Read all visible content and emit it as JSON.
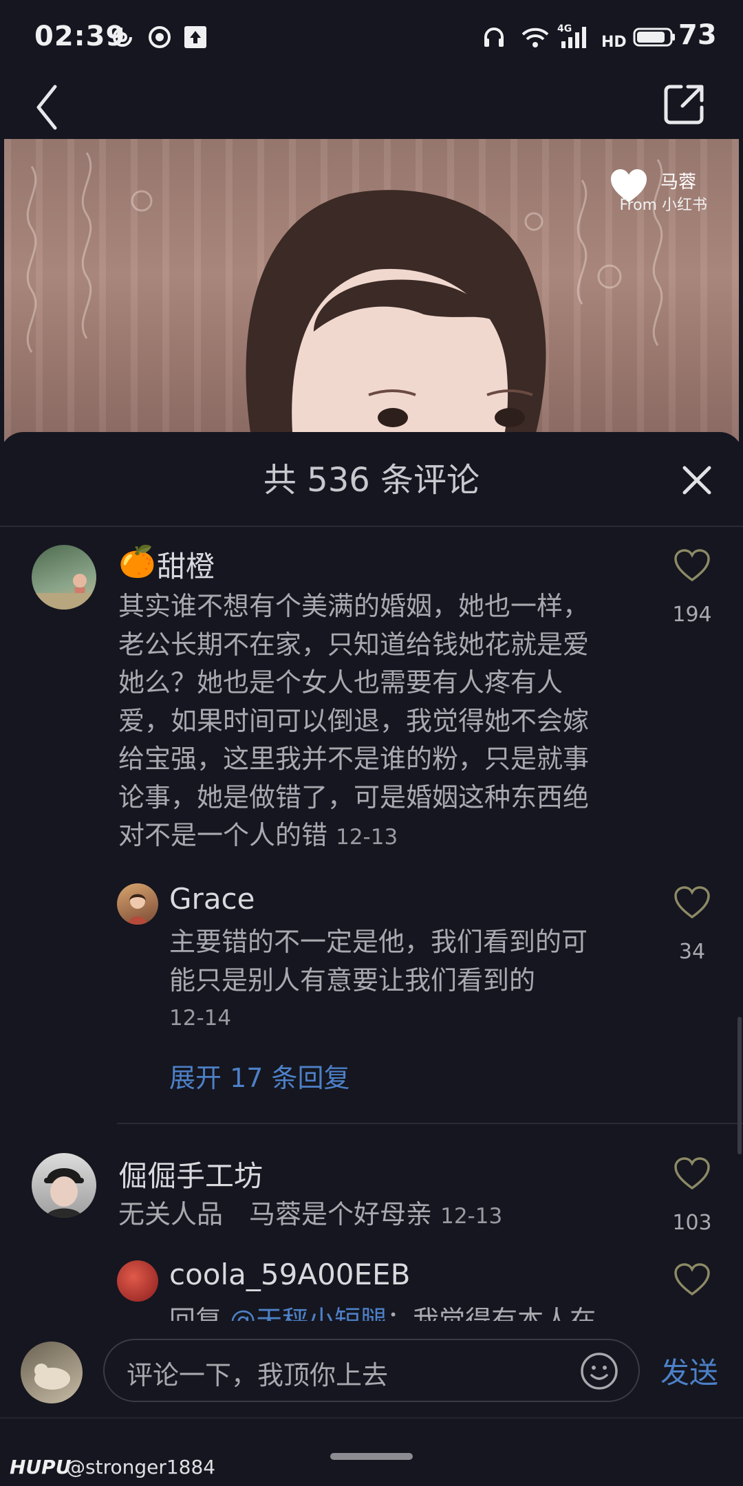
{
  "status_bar": {
    "time": "02:39",
    "network": "4G",
    "battery": "73"
  },
  "nav": {
    "back_icon": "chevron-left-icon",
    "share_icon": "share-external-icon"
  },
  "video": {
    "watermark_name": "马蓉",
    "watermark_source": "From 小红书"
  },
  "comments_sheet": {
    "title": "共 536 条评论",
    "close_icon": "close-icon"
  },
  "comments": [
    {
      "emoji": "🍊",
      "username": "甜橙",
      "lines": [
        "其实谁不想有个美满的婚姻，她也一样，",
        "老公长期不在家，只知道给钱她花就是爱",
        "她么？她也是个女人也需要有人疼有人",
        "爱，如果时间可以倒退，我觉得她不会嫁",
        "给宝强，这里我并不是谁的粉，只是就事",
        "论事，她是做错了，可是婚姻这种东西绝"
      ],
      "last_line": "对不是一个人的错",
      "date": "12-13",
      "likes": "194",
      "reply": {
        "username": "Grace",
        "lines": [
          "主要错的不一定是他，我们看到的可",
          "能只是别人有意要让我们看到的"
        ],
        "date": "12-14",
        "likes": "34"
      },
      "expand_replies": "展开 17 条回复"
    },
    {
      "username": "倔倔手工坊",
      "text": "无关人品　马蓉是个好母亲",
      "date": "12-13",
      "likes": "103",
      "reply": {
        "username": "coola_59A00EEB",
        "prefix": "回复 ",
        "mention": "@天秤小短腿",
        "text": "：我觉得有本人在"
      }
    }
  ],
  "input_bar": {
    "placeholder": "评论一下，我顶你上去",
    "send": "发送",
    "emoji_icon": "smiley-icon"
  },
  "watermark": {
    "brand": "HUPU",
    "user": "@stronger1884"
  },
  "colors": {
    "background": "#15161f",
    "accent_blue": "#4d80c7",
    "heart_stroke": "#8d8a66"
  }
}
